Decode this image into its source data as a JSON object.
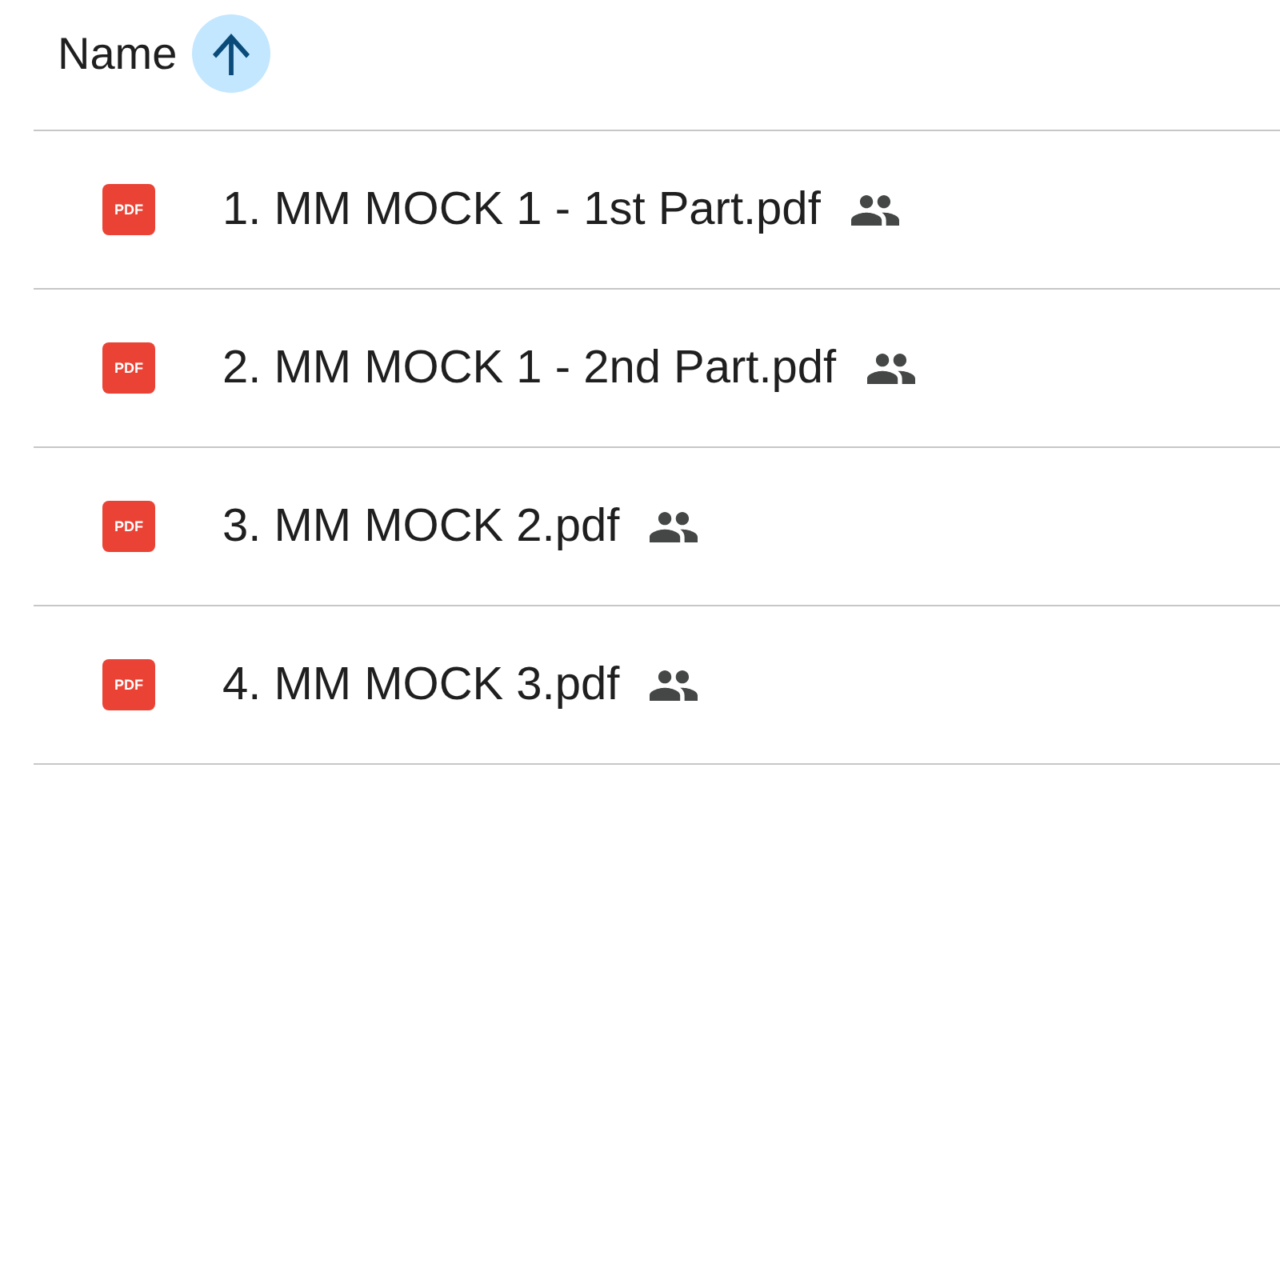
{
  "header": {
    "column": "Name",
    "sort": {
      "ascending": true
    }
  },
  "files": [
    {
      "badge": "PDF",
      "name": "1. MM MOCK 1 - 1st Part.pdf",
      "shared": true
    },
    {
      "badge": "PDF",
      "name": "2. MM MOCK 1 - 2nd Part.pdf",
      "shared": true
    },
    {
      "badge": "PDF",
      "name": "3. MM MOCK 2.pdf",
      "shared": true
    },
    {
      "badge": "PDF",
      "name": "4. MM MOCK 3.pdf",
      "shared": true
    }
  ]
}
